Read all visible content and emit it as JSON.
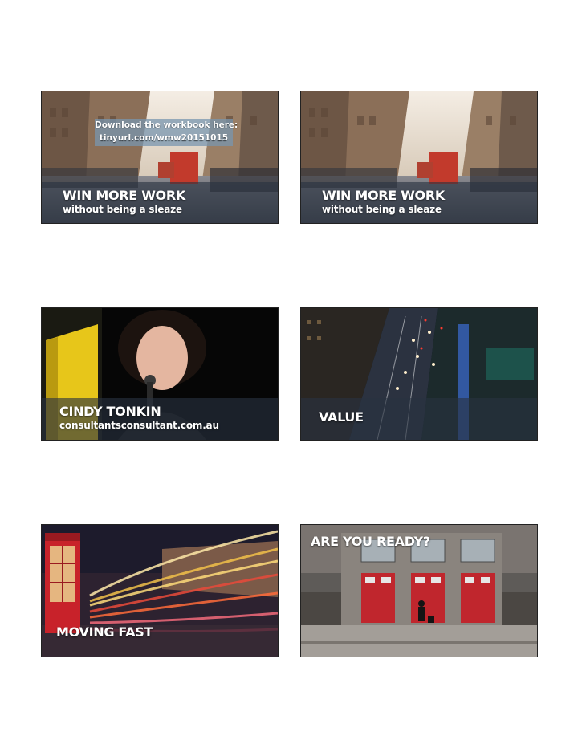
{
  "slides": [
    {
      "title": "WIN MORE WORK",
      "subtitle": "without being a sleaze",
      "download": {
        "line1": "Download the workbook here:",
        "line2": "tinyurl.com/wmw20151015"
      }
    },
    {
      "title": "WIN MORE WORK",
      "subtitle": "without being a sleaze"
    },
    {
      "title": "CINDY TONKIN",
      "subtitle": "consultantsconsultant.com.au"
    },
    {
      "title": "VALUE"
    },
    {
      "title": "MOVING FAST"
    },
    {
      "title": "ARE YOU READY?"
    }
  ]
}
